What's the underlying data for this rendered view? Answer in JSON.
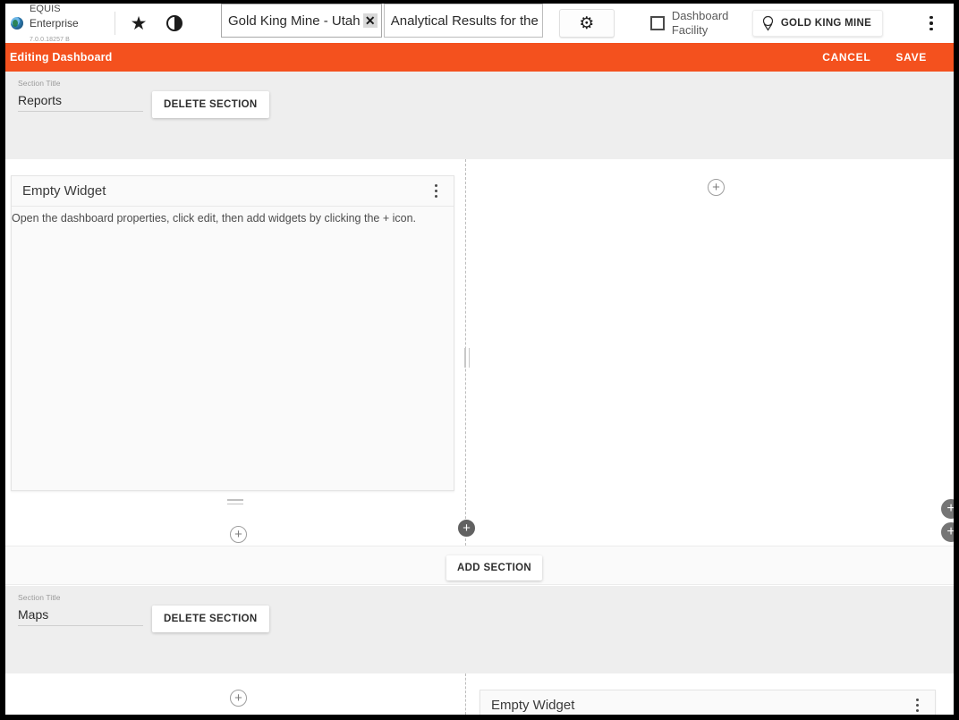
{
  "header": {
    "brand": {
      "line1": "EQUIS",
      "line2": "Enterprise",
      "version": "7.0.0.18257 B"
    },
    "favorites_icon": "star-icon",
    "contrast_icon": "contrast-icon",
    "tabs": [
      {
        "label": "Gold King Mine - Utah -",
        "closable": true,
        "close_glyph": "✕",
        "active": true
      },
      {
        "label": "Analytical Results for the",
        "closable": false,
        "active": false
      }
    ],
    "settings_icon": "gear-icon",
    "dashboard_facility": {
      "label": "Dashboard Facility",
      "checked": false
    },
    "site_selector": {
      "label": "GOLD KING MINE",
      "icon": "location-pin-icon"
    },
    "overflow_icon": "kebab-menu-icon"
  },
  "edit_bar": {
    "title": "Editing Dashboard",
    "cancel_label": "CANCEL",
    "save_label": "SAVE",
    "color": "#f4511e"
  },
  "sections": [
    {
      "title_label": "Section Title",
      "title_value": "Reports",
      "delete_label": "DELETE SECTION",
      "widgets": [
        {
          "title": "Empty Widget",
          "body": "Open the dashboard properties, click edit, then add widgets by clicking the + icon.",
          "menu_icon": "kebab-menu-icon"
        }
      ],
      "add_widget_glyph": "+"
    },
    {
      "title_label": "Section Title",
      "title_value": "Maps",
      "delete_label": "DELETE SECTION",
      "widgets": [
        {
          "title": "Empty Widget",
          "body": "",
          "menu_icon": "kebab-menu-icon"
        }
      ],
      "add_widget_glyph": "+"
    }
  ],
  "add_section_label": "ADD SECTION",
  "add_glyph": "+",
  "colors": {
    "accent": "#f4511e",
    "section_header_bg": "#eeeeee",
    "widget_bg": "#fafafa",
    "page_bg": "#ffffff"
  }
}
